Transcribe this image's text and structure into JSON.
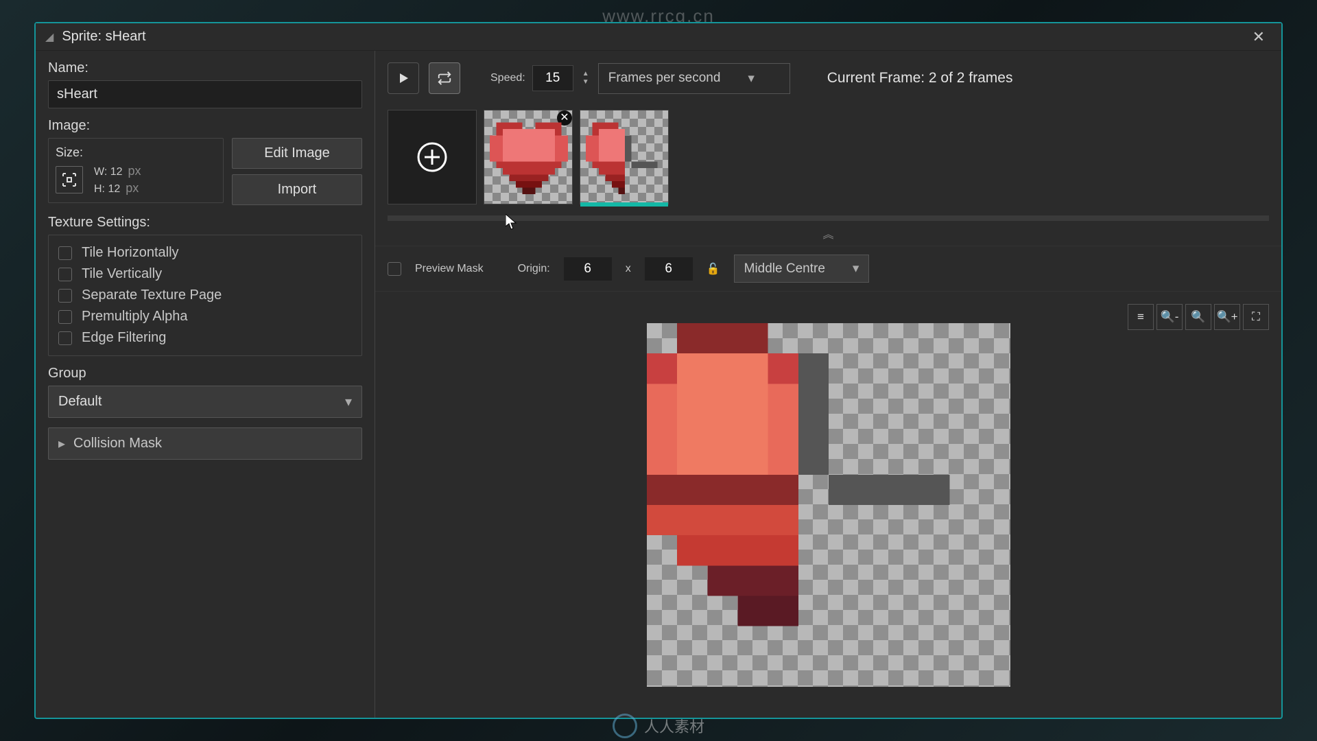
{
  "watermark_url": "www.rrcg.cn",
  "window": {
    "title": "Sprite: sHeart"
  },
  "sidebar": {
    "name_label": "Name:",
    "name_value": "sHeart",
    "image_label": "Image:",
    "size_label": "Size:",
    "size_w_label": "W:",
    "size_w_value": "12",
    "size_h_label": "H:",
    "size_h_value": "12",
    "size_unit": "px",
    "edit_image_btn": "Edit Image",
    "import_btn": "Import",
    "texture_settings_label": "Texture Settings:",
    "checks": [
      "Tile Horizontally",
      "Tile Vertically",
      "Separate Texture Page",
      "Premultiply Alpha",
      "Edge Filtering"
    ],
    "group_label": "Group",
    "group_value": "Default",
    "collision_mask_label": "Collision Mask"
  },
  "toolbar": {
    "speed_label": "Speed:",
    "speed_value": "15",
    "speed_unit": "Frames per second",
    "current_frame": "Current Frame: 2 of 2 frames"
  },
  "originbar": {
    "preview_mask_label": "Preview Mask",
    "origin_label": "Origin:",
    "origin_x": "6",
    "origin_sep": "x",
    "origin_y": "6",
    "anchor_value": "Middle Centre"
  },
  "footer_text": "人人素材"
}
